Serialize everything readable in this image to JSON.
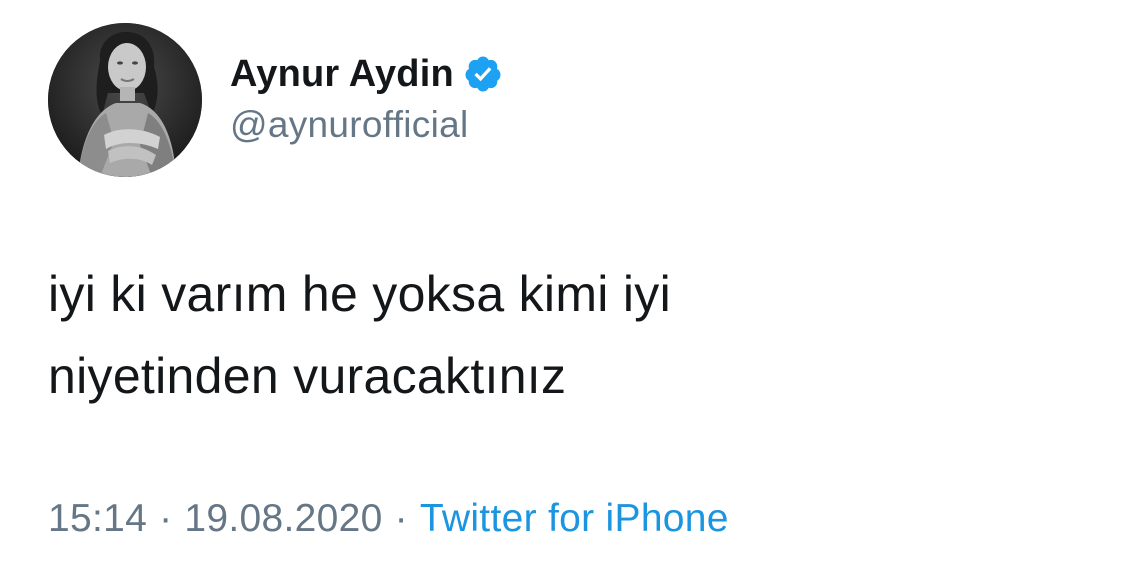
{
  "author": {
    "display_name": "Aynur Aydin",
    "handle": "@aynurofficial",
    "verified_icon": "verified-badge-icon"
  },
  "tweet": {
    "lines": [
      "iyi ki varım he yoksa kimi iyi",
      "niyetinden vuracaktınız"
    ]
  },
  "meta": {
    "time": "15:14",
    "separator": "·",
    "date": "19.08.2020",
    "source": "Twitter for iPhone"
  },
  "colors": {
    "text": "#14171a",
    "secondary": "#657786",
    "link": "#1b95e0",
    "verified": "#1da1f2"
  }
}
